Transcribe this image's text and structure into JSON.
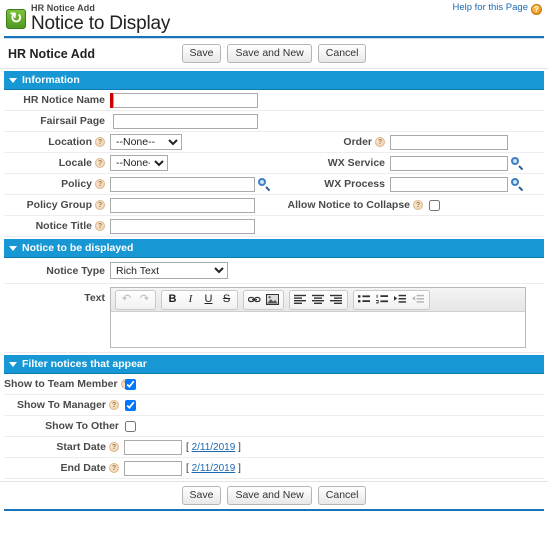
{
  "header": {
    "icon_name": "hr-notice-icon",
    "subtitle": "HR Notice Add",
    "title": "Notice to Display",
    "help_label": "Help for this Page",
    "help_icon": "help-question-icon"
  },
  "toolbar": {
    "section_title": "HR Notice Add",
    "save_label": "Save",
    "save_and_new_label": "Save and New",
    "cancel_label": "Cancel"
  },
  "sections": {
    "information": {
      "title": "Information",
      "fields": {
        "hr_notice_name": {
          "label": "HR Notice Name",
          "value": "",
          "required": true
        },
        "fairsail_page": {
          "label": "Fairsail Page",
          "value": ""
        },
        "location": {
          "label": "Location",
          "value": "--None--",
          "options": [
            "--None--"
          ]
        },
        "order": {
          "label": "Order",
          "value": ""
        },
        "locale": {
          "label": "Locale",
          "value": "--None--",
          "options": [
            "--None--"
          ]
        },
        "wx_service": {
          "label": "WX Service",
          "value": ""
        },
        "policy": {
          "label": "Policy",
          "value": ""
        },
        "wx_process": {
          "label": "WX Process",
          "value": ""
        },
        "policy_group": {
          "label": "Policy Group",
          "value": ""
        },
        "allow_notice_to_collapse": {
          "label": "Allow Notice to Collapse",
          "checked": false
        },
        "notice_title": {
          "label": "Notice Title",
          "value": ""
        }
      }
    },
    "notice_to_be_displayed": {
      "title": "Notice to be displayed",
      "fields": {
        "notice_type": {
          "label": "Notice Type",
          "value": "Rich Text",
          "options": [
            "Rich Text"
          ]
        },
        "text": {
          "label": "Text",
          "value": ""
        }
      },
      "editor_buttons": [
        {
          "name": "undo",
          "glyph": "↶",
          "dim": true
        },
        {
          "name": "redo",
          "glyph": "↷",
          "dim": true
        },
        {
          "name": "bold",
          "glyph": "B"
        },
        {
          "name": "italic",
          "glyph": "I"
        },
        {
          "name": "underline",
          "glyph": "U"
        },
        {
          "name": "strikethrough",
          "glyph": "S"
        },
        {
          "name": "link",
          "glyph": "⚭"
        },
        {
          "name": "image",
          "glyph": "▣"
        },
        {
          "name": "align-left",
          "glyph": "≡"
        },
        {
          "name": "align-center",
          "glyph": "≡"
        },
        {
          "name": "align-right",
          "glyph": "≡"
        },
        {
          "name": "bulleted-list",
          "glyph": "•"
        },
        {
          "name": "numbered-list",
          "glyph": "1."
        },
        {
          "name": "indent",
          "glyph": "⇥"
        },
        {
          "name": "outdent",
          "glyph": "⇤",
          "dim": true
        }
      ]
    },
    "filter_notices": {
      "title": "Filter notices that appear",
      "fields": {
        "show_to_team_member": {
          "label": "Show to Team Member",
          "checked": true
        },
        "show_to_manager": {
          "label": "Show To Manager",
          "checked": true
        },
        "show_to_other": {
          "label": "Show To Other",
          "checked": false
        },
        "start_date": {
          "label": "Start Date",
          "value": "",
          "today": "2/11/2019"
        },
        "end_date": {
          "label": "End Date",
          "value": "",
          "today": "2/11/2019"
        }
      },
      "date_bracket_open": "[",
      "date_bracket_close": "]"
    }
  },
  "footer": {
    "save_label": "Save",
    "save_and_new_label": "Save and New",
    "cancel_label": "Cancel"
  },
  "colors": {
    "section_header_bg": "#1797d3",
    "accent_rule": "#1a72b8",
    "required_bar": "#cc0000",
    "link": "#1b68b3"
  }
}
